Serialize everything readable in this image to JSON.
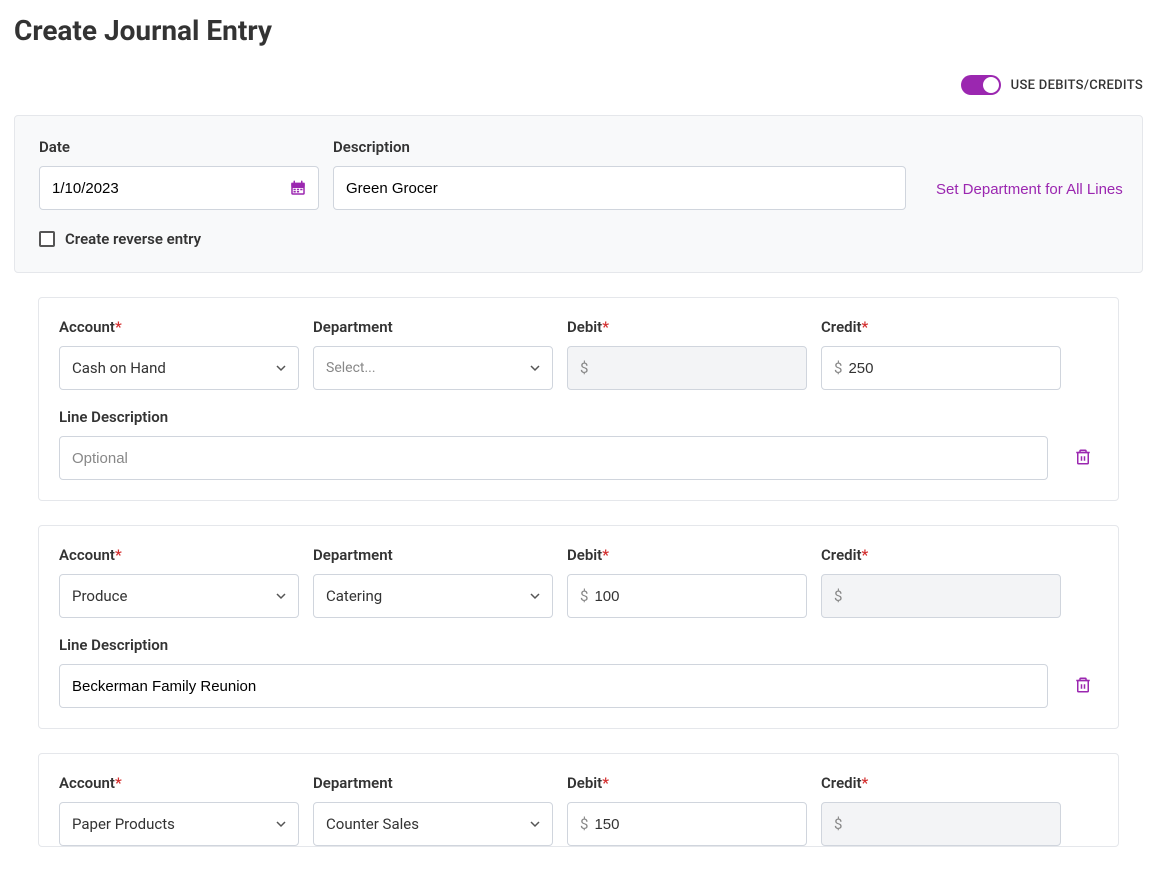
{
  "page_title": "Create Journal Entry",
  "toggle": {
    "label": "USE DEBITS/CREDITS",
    "on": true
  },
  "header": {
    "date_label": "Date",
    "date_value": "1/10/2023",
    "description_label": "Description",
    "description_value": "Green Grocer",
    "set_department_link": "Set Department for All Lines",
    "reverse_checkbox_label": "Create reverse entry",
    "reverse_checked": false
  },
  "labels": {
    "account": "Account",
    "department": "Department",
    "debit": "Debit",
    "credit": "Credit",
    "line_description": "Line Description",
    "select_placeholder": "Select...",
    "optional_placeholder": "Optional",
    "currency": "$"
  },
  "lines": [
    {
      "account": "Cash on Hand",
      "department": "",
      "debit": "",
      "debit_disabled": true,
      "credit": "250",
      "credit_disabled": false,
      "line_description": ""
    },
    {
      "account": "Produce",
      "department": "Catering",
      "debit": "100",
      "debit_disabled": false,
      "credit": "",
      "credit_disabled": true,
      "line_description": "Beckerman Family Reunion"
    },
    {
      "account": "Paper Products",
      "department": "Counter Sales",
      "debit": "150",
      "debit_disabled": false,
      "credit": "",
      "credit_disabled": true,
      "line_description": ""
    }
  ]
}
